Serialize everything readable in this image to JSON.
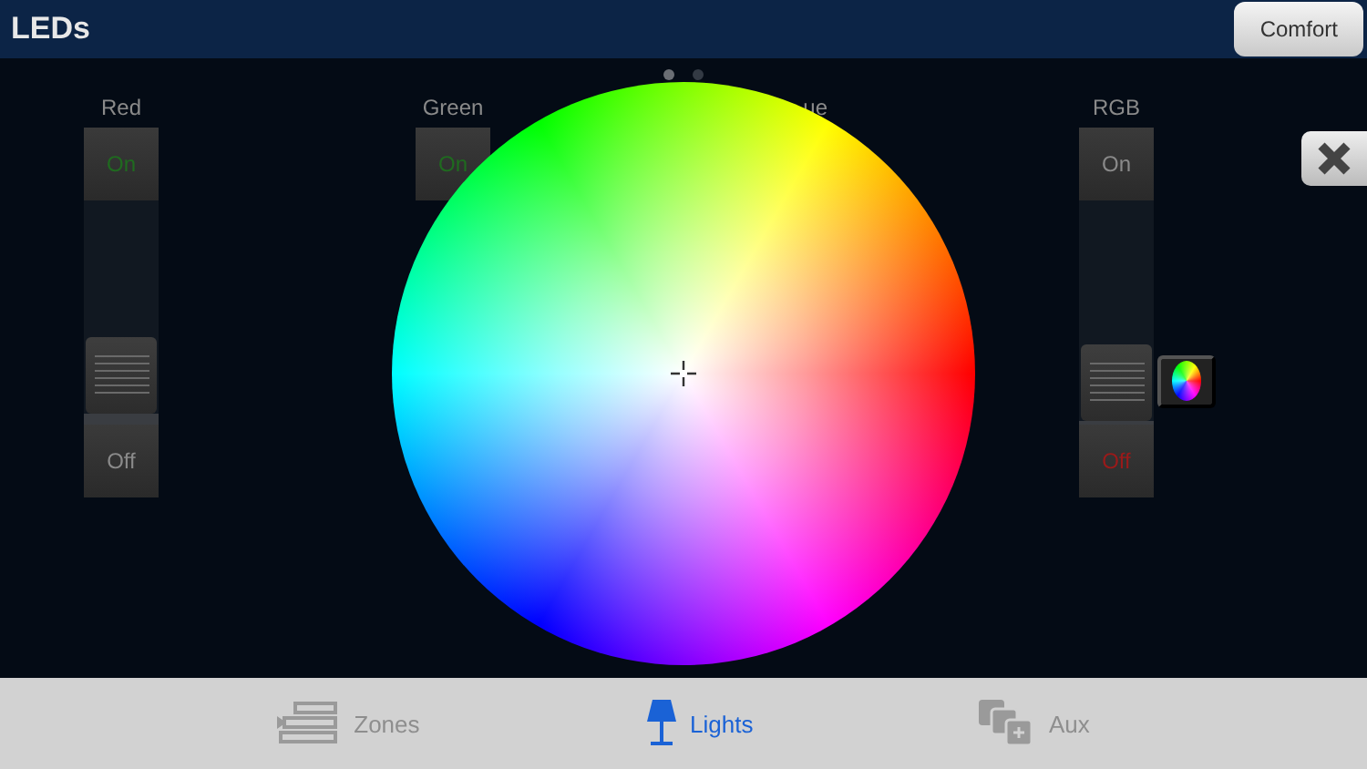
{
  "header": {
    "title": "LEDs",
    "mode_button": "Comfort"
  },
  "page_dots": [
    {
      "selected": true
    },
    {
      "selected": false
    }
  ],
  "channels": [
    {
      "kind": "slider",
      "label": "Red",
      "on_label": "On",
      "off_label": "Off",
      "on": true,
      "level": 0.05
    },
    {
      "kind": "covered",
      "label": "Green",
      "on_label": "On",
      "on": true
    },
    {
      "kind": "label",
      "label": "ue"
    },
    {
      "kind": "slider",
      "label": "RGB",
      "on_label": "On",
      "off_label": "Off",
      "on": false,
      "level": 0.02,
      "color_picker": true
    }
  ],
  "tabs": [
    {
      "label": "Zones",
      "selected": false
    },
    {
      "label": "Lights",
      "selected": true
    },
    {
      "label": "Aux",
      "selected": false
    }
  ]
}
